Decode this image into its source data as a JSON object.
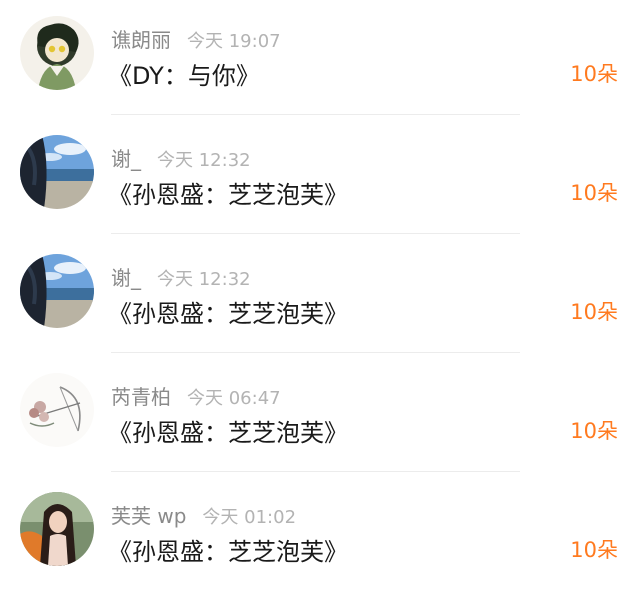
{
  "colors": {
    "name": "#8a8a8a",
    "time": "#b3b3b3",
    "title": "#1a1a1a",
    "amount": "#ff7a1f",
    "divider": "#ececec"
  },
  "records": [
    {
      "avatar": "avatar-icon",
      "name": "谯朗丽",
      "time": "今天 19:07",
      "title": "《DY：与你》",
      "amount": "10朵"
    },
    {
      "avatar": "avatar-icon",
      "name": "谢_",
      "time": "今天 12:32",
      "title": "《孙恩盛：芝芝泡芙》",
      "amount": "10朵"
    },
    {
      "avatar": "avatar-icon",
      "name": "谢_",
      "time": "今天 12:32",
      "title": "《孙恩盛：芝芝泡芙》",
      "amount": "10朵"
    },
    {
      "avatar": "avatar-icon",
      "name": "芮青柏",
      "time": "今天 06:47",
      "title": "《孙恩盛：芝芝泡芙》",
      "amount": "10朵"
    },
    {
      "avatar": "avatar-icon",
      "name": "芙芙 wp",
      "time": "今天 01:02",
      "title": "《孙恩盛：芝芝泡芙》",
      "amount": "10朵"
    }
  ]
}
